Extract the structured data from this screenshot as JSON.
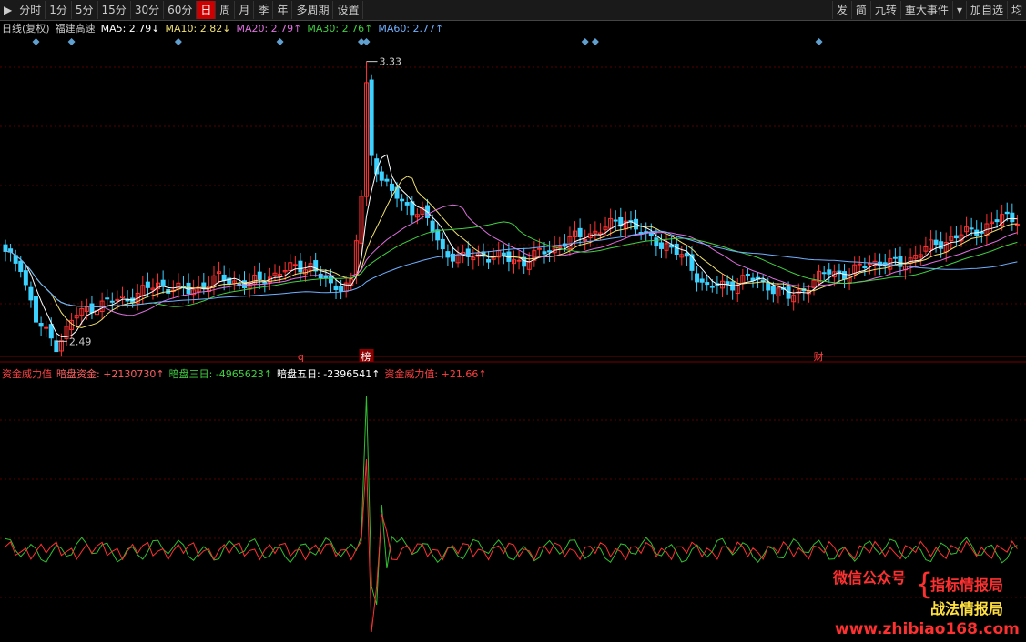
{
  "toolbar": {
    "tabs": [
      "分时",
      "1分",
      "5分",
      "15分",
      "30分",
      "60分",
      "日",
      "周",
      "月",
      "季",
      "年",
      "多周期",
      "设置"
    ],
    "active": "日",
    "right": [
      "发",
      "简",
      "九转",
      "重大事件",
      "加自选",
      "均"
    ]
  },
  "main_legend": {
    "period": "日线(复权)",
    "stock": "福建高速",
    "ma": [
      {
        "label": "MA5: 2.79↓",
        "color": "#ffffff"
      },
      {
        "label": "MA10: 2.82↓",
        "color": "#f0e070"
      },
      {
        "label": "MA20: 2.79↑",
        "color": "#e070e0"
      },
      {
        "label": "MA30: 2.76↑",
        "color": "#40d040"
      },
      {
        "label": "MA60: 2.77↑",
        "color": "#70b0ff"
      }
    ]
  },
  "sub_legend": [
    {
      "label": "资金威力值",
      "color": "#ff4040"
    },
    {
      "label": "暗盘资金: +2130730↑",
      "color": "#ff6060"
    },
    {
      "label": "暗盘三日: -4965623↑",
      "color": "#40d040"
    },
    {
      "label": "暗盘五日: -2396541↑",
      "color": "#ffffff"
    },
    {
      "label": "资金威力值: +21.66↑",
      "color": "#ff4040"
    }
  ],
  "markers": {
    "q": "q",
    "bang": "榜",
    "cai": "财"
  },
  "watermark": {
    "wechat": "微信公众号",
    "line1": "指标情报局",
    "line2": "战法情报局",
    "url": "www.zhibiao168.com"
  },
  "chart_data": {
    "type": "candlestick",
    "high_label": "3.33",
    "low_label": "2.49",
    "ylim": [
      2.45,
      3.4
    ],
    "up_color": "#ff3030",
    "down_color": "#3cd2ff",
    "close_anchors": [
      [
        0,
        2.75
      ],
      [
        3,
        2.72
      ],
      [
        6,
        2.55
      ],
      [
        10,
        2.48
      ],
      [
        14,
        2.57
      ],
      [
        18,
        2.6
      ],
      [
        24,
        2.62
      ],
      [
        30,
        2.66
      ],
      [
        36,
        2.64
      ],
      [
        42,
        2.68
      ],
      [
        48,
        2.66
      ],
      [
        54,
        2.7
      ],
      [
        60,
        2.72
      ],
      [
        64,
        2.65
      ],
      [
        68,
        2.67
      ],
      [
        70,
        2.92
      ],
      [
        71,
        3.25
      ],
      [
        72,
        3.05
      ],
      [
        74,
        2.98
      ],
      [
        78,
        2.9
      ],
      [
        82,
        2.88
      ],
      [
        86,
        2.76
      ],
      [
        90,
        2.74
      ],
      [
        94,
        2.75
      ],
      [
        98,
        2.74
      ],
      [
        102,
        2.73
      ],
      [
        106,
        2.76
      ],
      [
        112,
        2.8
      ],
      [
        118,
        2.83
      ],
      [
        122,
        2.86
      ],
      [
        126,
        2.8
      ],
      [
        130,
        2.78
      ],
      [
        134,
        2.73
      ],
      [
        138,
        2.65
      ],
      [
        142,
        2.66
      ],
      [
        146,
        2.68
      ],
      [
        150,
        2.66
      ],
      [
        154,
        2.62
      ],
      [
        158,
        2.66
      ],
      [
        162,
        2.7
      ],
      [
        166,
        2.69
      ],
      [
        170,
        2.73
      ],
      [
        176,
        2.72
      ],
      [
        180,
        2.76
      ],
      [
        186,
        2.8
      ],
      [
        192,
        2.83
      ],
      [
        196,
        2.86
      ]
    ],
    "ma_lines": [
      "MA5",
      "MA10",
      "MA20",
      "MA30",
      "MA60"
    ],
    "sub_type": "line",
    "sub_series": [
      "资金威力值",
      "暗盘三日"
    ],
    "sub_spike_index": 71
  }
}
